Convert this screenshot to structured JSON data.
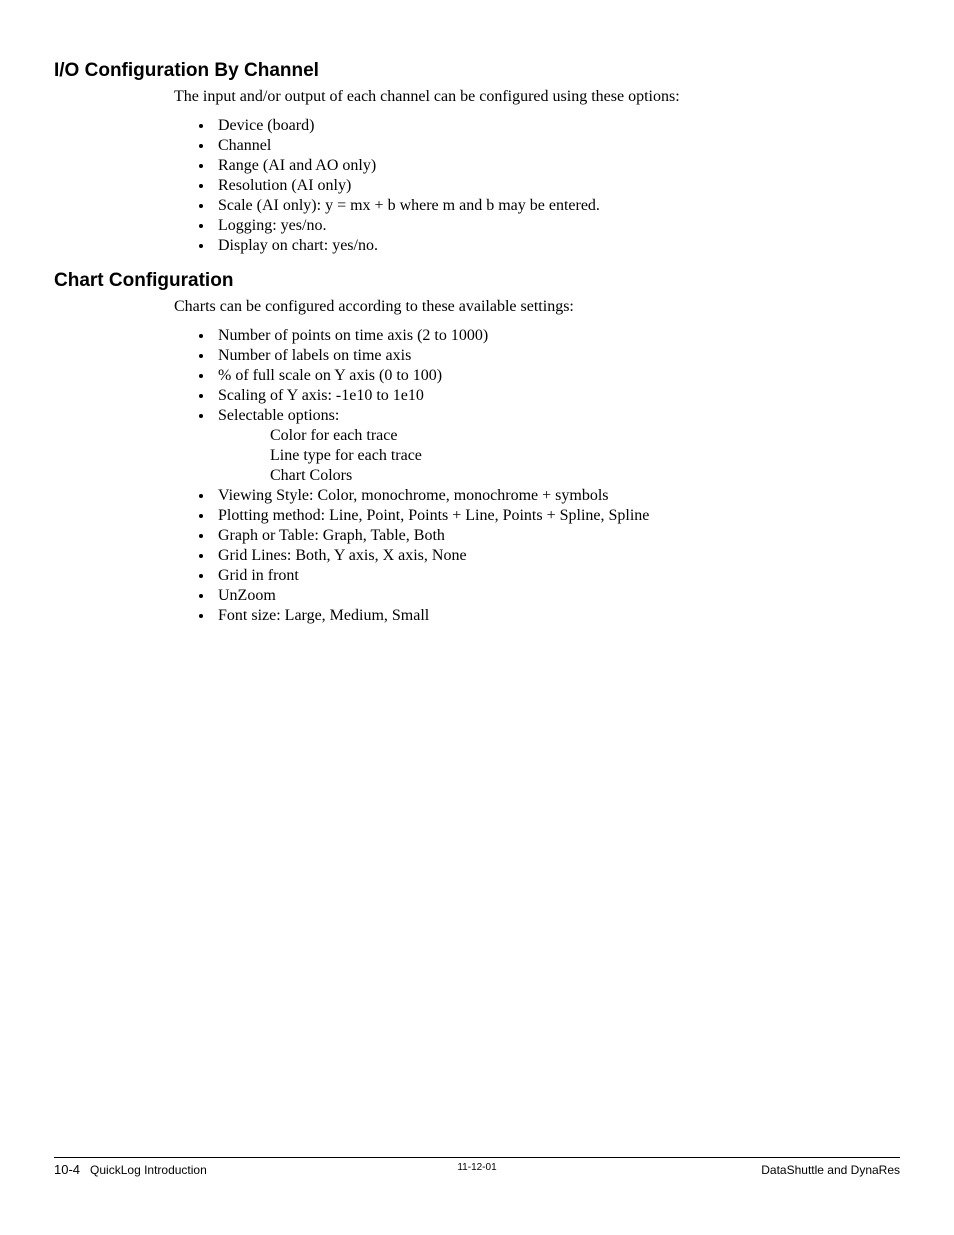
{
  "section1": {
    "heading": "I/O Configuration By Channel",
    "intro": "The input and/or output of each channel can be configured using these options:",
    "items": [
      "Device (board)",
      "Channel",
      "Range (AI and AO only)",
      "Resolution (AI only)",
      "Scale (AI only): y = mx + b where m and b may be entered.",
      "Logging: yes/no.",
      "Display on chart: yes/no."
    ]
  },
  "section2": {
    "heading": "Chart Configuration",
    "intro": "Charts can be configured according to these available settings:",
    "items_a": [
      "Number of points on time axis (2 to 1000)",
      "Number of labels on time axis",
      "% of full scale on Y axis (0 to 100)",
      "Scaling of Y axis: -1e10 to 1e10",
      "Selectable options:"
    ],
    "sub_items": [
      "Color for each trace",
      "Line type for each trace",
      "Chart Colors"
    ],
    "items_b": [
      "Viewing Style: Color, monochrome, monochrome + symbols",
      "Plotting method: Line, Point, Points + Line, Points + Spline, Spline",
      "Graph or Table: Graph, Table, Both",
      "Grid Lines: Both, Y axis, X axis, None",
      "Grid in front",
      "UnZoom",
      "Font size: Large, Medium, Small"
    ]
  },
  "footer": {
    "page": "10-4",
    "left": "QuickLog Introduction",
    "center": "11-12-01",
    "right": "DataShuttle and DynaRes"
  }
}
